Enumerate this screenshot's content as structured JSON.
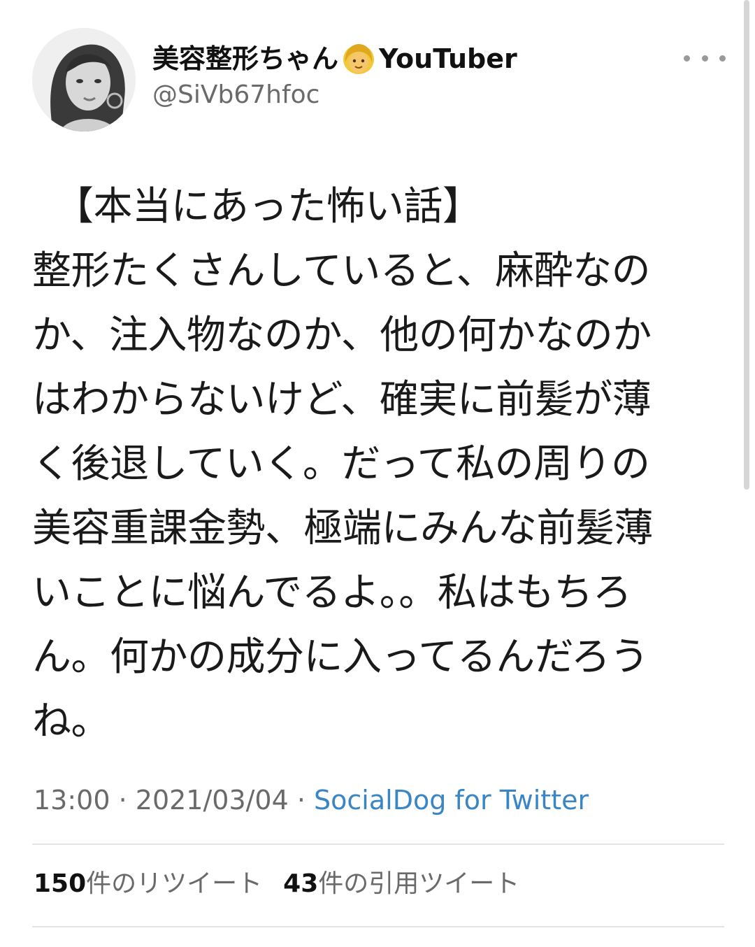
{
  "tweet": {
    "display_name": "美容整形ちゃん",
    "display_name_emoji": "woman-blond-hair-emoji",
    "display_name_suffix": "YouTuber",
    "handle": "@SiVb67hfoc",
    "text_lines": [
      "【本当にあった怖い話】",
      "整形たくさんしていると、麻酔なの",
      "か、注入物なのか、他の何かなのか",
      "はわからないけど、確実に前髪が薄",
      "く後退していく。だって私の周りの",
      "美容重課金勢、極端にみんな前髪薄",
      "いことに悩んでるよ。。私はもちろ",
      "ん。何かの成分に入ってるんだろう",
      "ね。"
    ],
    "time": "13:00",
    "date": "2021/03/04",
    "source": "SocialDog for Twitter",
    "separator": " · "
  },
  "stats": {
    "retweets_count": "150",
    "retweets_label": "件のリツイート",
    "quotes_count": "43",
    "quotes_label": "件の引用ツイート"
  },
  "icons": {
    "more": "more-horizontal-icon",
    "avatar": "profile-avatar"
  },
  "colors": {
    "source_link": "#3a86c4",
    "muted_text": "#6a6a6a",
    "primary_text": "#111111"
  }
}
